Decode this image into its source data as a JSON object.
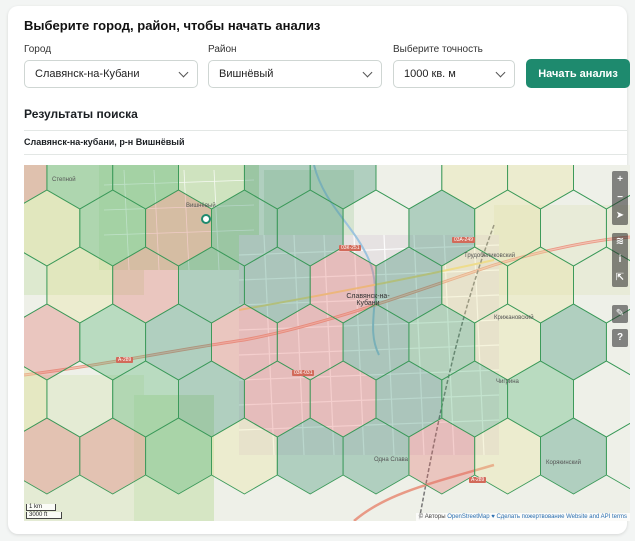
{
  "form": {
    "title": "Выберите город, район, чтобы начать анализ",
    "city_label": "Город",
    "city_value": "Славянск-на-Кубани",
    "district_label": "Район",
    "district_value": "Вишнёвый",
    "precision_label": "Выберите точность",
    "precision_value": "1000 кв. м",
    "start_button": "Начать анализ"
  },
  "results": {
    "title": "Результаты поиска",
    "location": "Славянск-на-кубани, р-н Вишнёвый"
  },
  "map": {
    "labels": {
      "steppe": "Степной",
      "vishnevy": "Вишнёвый",
      "city": "Славянск-на-Кубани",
      "trudobelikovsky": "Трудобеликовский",
      "krizhanovsky": "Крижановский",
      "chigrina": "Чигрина",
      "koryakinsky": "Корякинский",
      "odna_slava": "Одна Слава"
    },
    "roads": {
      "a289_left": "А-289",
      "a289_bottom": "А-289",
      "r251": "03К-251",
      "r249": "03А-249",
      "r031": "03К-031"
    },
    "scale": {
      "km": "1 km",
      "ft": "3000 ft"
    },
    "attribution": {
      "authors": "© Авторы",
      "osm": "OpenStreetMap",
      "fix": "♥ Сделать пожертвование",
      "website": "Website and API terms"
    },
    "controls": {
      "zoom_in": "+",
      "zoom_out": "−",
      "locate": "➤",
      "layers": "≋",
      "info": "i",
      "share": "⇱",
      "note": "✎",
      "query": "?"
    },
    "colors": {
      "green": "#4caf6d",
      "red": "#e36d6a",
      "teal": "#2f8a6a",
      "yellow": "#e8e49a",
      "hex_stroke": "#3c9a5a"
    }
  }
}
